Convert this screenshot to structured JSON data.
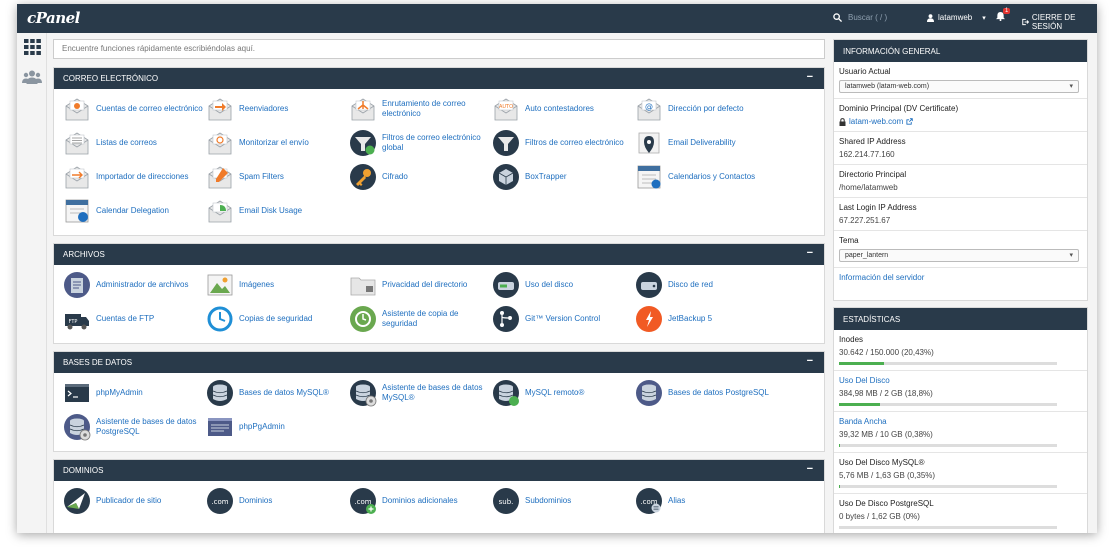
{
  "topbar": {
    "logo": "cPanel",
    "search_placeholder": "Buscar ( / )",
    "user": "latamweb",
    "notifications_count": "1",
    "logout": "CIERRE DE SESIÓN"
  },
  "search": {
    "placeholder": "Encuentre funciones rápidamente escribiéndolas aquí."
  },
  "sections": {
    "email": {
      "title": "CORREO ELECTRÓNICO",
      "items": [
        {
          "label": "Cuentas de correo electrónico",
          "icon": "email-accounts-icon"
        },
        {
          "label": "Reenviadores",
          "icon": "forwarders-icon"
        },
        {
          "label": "Enrutamiento de correo electrónico",
          "icon": "email-routing-icon"
        },
        {
          "label": "Auto contestadores",
          "icon": "autoresponders-icon"
        },
        {
          "label": "Dirección por defecto",
          "icon": "default-address-icon"
        },
        {
          "label": "Listas de correos",
          "icon": "mailing-lists-icon"
        },
        {
          "label": "Monitorizar el envío",
          "icon": "track-delivery-icon"
        },
        {
          "label": "Filtros de correo electrónico global",
          "icon": "global-filters-icon"
        },
        {
          "label": "Filtros de correo electrónico",
          "icon": "email-filters-icon"
        },
        {
          "label": "Email Deliverability",
          "icon": "deliverability-icon"
        },
        {
          "label": "Importador de direcciones",
          "icon": "address-importer-icon"
        },
        {
          "label": "Spam Filters",
          "icon": "spam-filters-icon"
        },
        {
          "label": "Cifrado",
          "icon": "encryption-icon"
        },
        {
          "label": "BoxTrapper",
          "icon": "boxtrapper-icon"
        },
        {
          "label": "Calendarios y Contactos",
          "icon": "calendars-icon"
        },
        {
          "label": "Calendar Delegation",
          "icon": "calendar-delegation-icon"
        },
        {
          "label": "Email Disk Usage",
          "icon": "email-disk-usage-icon"
        }
      ]
    },
    "files": {
      "title": "ARCHIVOS",
      "items": [
        {
          "label": "Administrador de archivos",
          "icon": "file-manager-icon"
        },
        {
          "label": "Imágenes",
          "icon": "images-icon"
        },
        {
          "label": "Privacidad del directorio",
          "icon": "directory-privacy-icon"
        },
        {
          "label": "Uso del disco",
          "icon": "disk-usage-icon"
        },
        {
          "label": "Disco de red",
          "icon": "web-disk-icon"
        },
        {
          "label": "Cuentas de FTP",
          "icon": "ftp-accounts-icon"
        },
        {
          "label": "Copias de seguridad",
          "icon": "backup-icon"
        },
        {
          "label": "Asistente de copia de seguridad",
          "icon": "backup-wizard-icon"
        },
        {
          "label": "Git™ Version Control",
          "icon": "git-icon"
        },
        {
          "label": "JetBackup 5",
          "icon": "jetbackup-icon"
        }
      ]
    },
    "databases": {
      "title": "BASES DE DATOS",
      "items": [
        {
          "label": "phpMyAdmin",
          "icon": "phpmyadmin-icon"
        },
        {
          "label": "Bases de datos MySQL®",
          "icon": "mysql-databases-icon"
        },
        {
          "label": "Asistente de bases de datos MySQL®",
          "icon": "mysql-wizard-icon"
        },
        {
          "label": "MySQL remoto®",
          "icon": "remote-mysql-icon"
        },
        {
          "label": "Bases de datos PostgreSQL",
          "icon": "postgresql-databases-icon"
        },
        {
          "label": "Asistente de bases de datos PostgreSQL",
          "icon": "postgresql-wizard-icon"
        },
        {
          "label": "phpPgAdmin",
          "icon": "phppgadmin-icon"
        }
      ]
    },
    "domains": {
      "title": "DOMINIOS",
      "items": [
        {
          "label": "Publicador de sitio",
          "icon": "site-publisher-icon"
        },
        {
          "label": "Dominios",
          "icon": "domains-icon"
        },
        {
          "label": "Dominios adicionales",
          "icon": "addon-domains-icon"
        },
        {
          "label": "Subdominios",
          "icon": "subdomains-icon"
        },
        {
          "label": "Alias",
          "icon": "aliases-icon"
        }
      ]
    }
  },
  "general_info": {
    "title": "INFORMACIÓN GENERAL",
    "current_user_label": "Usuario Actual",
    "current_user_value": "latamweb (latam-web.com)",
    "primary_domain_label": "Dominio Principal (DV Certificate)",
    "primary_domain_value": "latam-web.com",
    "shared_ip_label": "Shared IP Address",
    "shared_ip_value": "162.214.77.160",
    "home_dir_label": "Directorio Principal",
    "home_dir_value": "/home/latamweb",
    "last_login_label": "Last Login IP Address",
    "last_login_value": "67.227.251.67",
    "theme_label": "Tema",
    "theme_value": "paper_lantern",
    "server_info_link": "Información del servidor"
  },
  "stats": {
    "title": "ESTADÍSTICAS",
    "items": [
      {
        "label": "Inodes",
        "value": "30.642 / 150.000  (20,43%)",
        "percent": 20.43,
        "link": false
      },
      {
        "label": "Uso Del Disco",
        "value": "384,98 MB / 2 GB  (18,8%)",
        "percent": 18.8,
        "link": true
      },
      {
        "label": "Banda Ancha",
        "value": "39,32 MB / 10 GB  (0,38%)",
        "percent": 0.38,
        "link": true
      },
      {
        "label": "Uso Del Disco MySQL®",
        "value": "5,76 MB / 1,63 GB  (0,35%)",
        "percent": 0.35,
        "link": false
      },
      {
        "label": "Uso De Disco PostgreSQL",
        "value": "0 bytes / 1,62 GB  (0%)",
        "percent": 0,
        "link": false
      }
    ]
  },
  "colors": {
    "header": "#293a4a",
    "link": "#1f6fbf",
    "bar_fill": "#4caf50"
  }
}
